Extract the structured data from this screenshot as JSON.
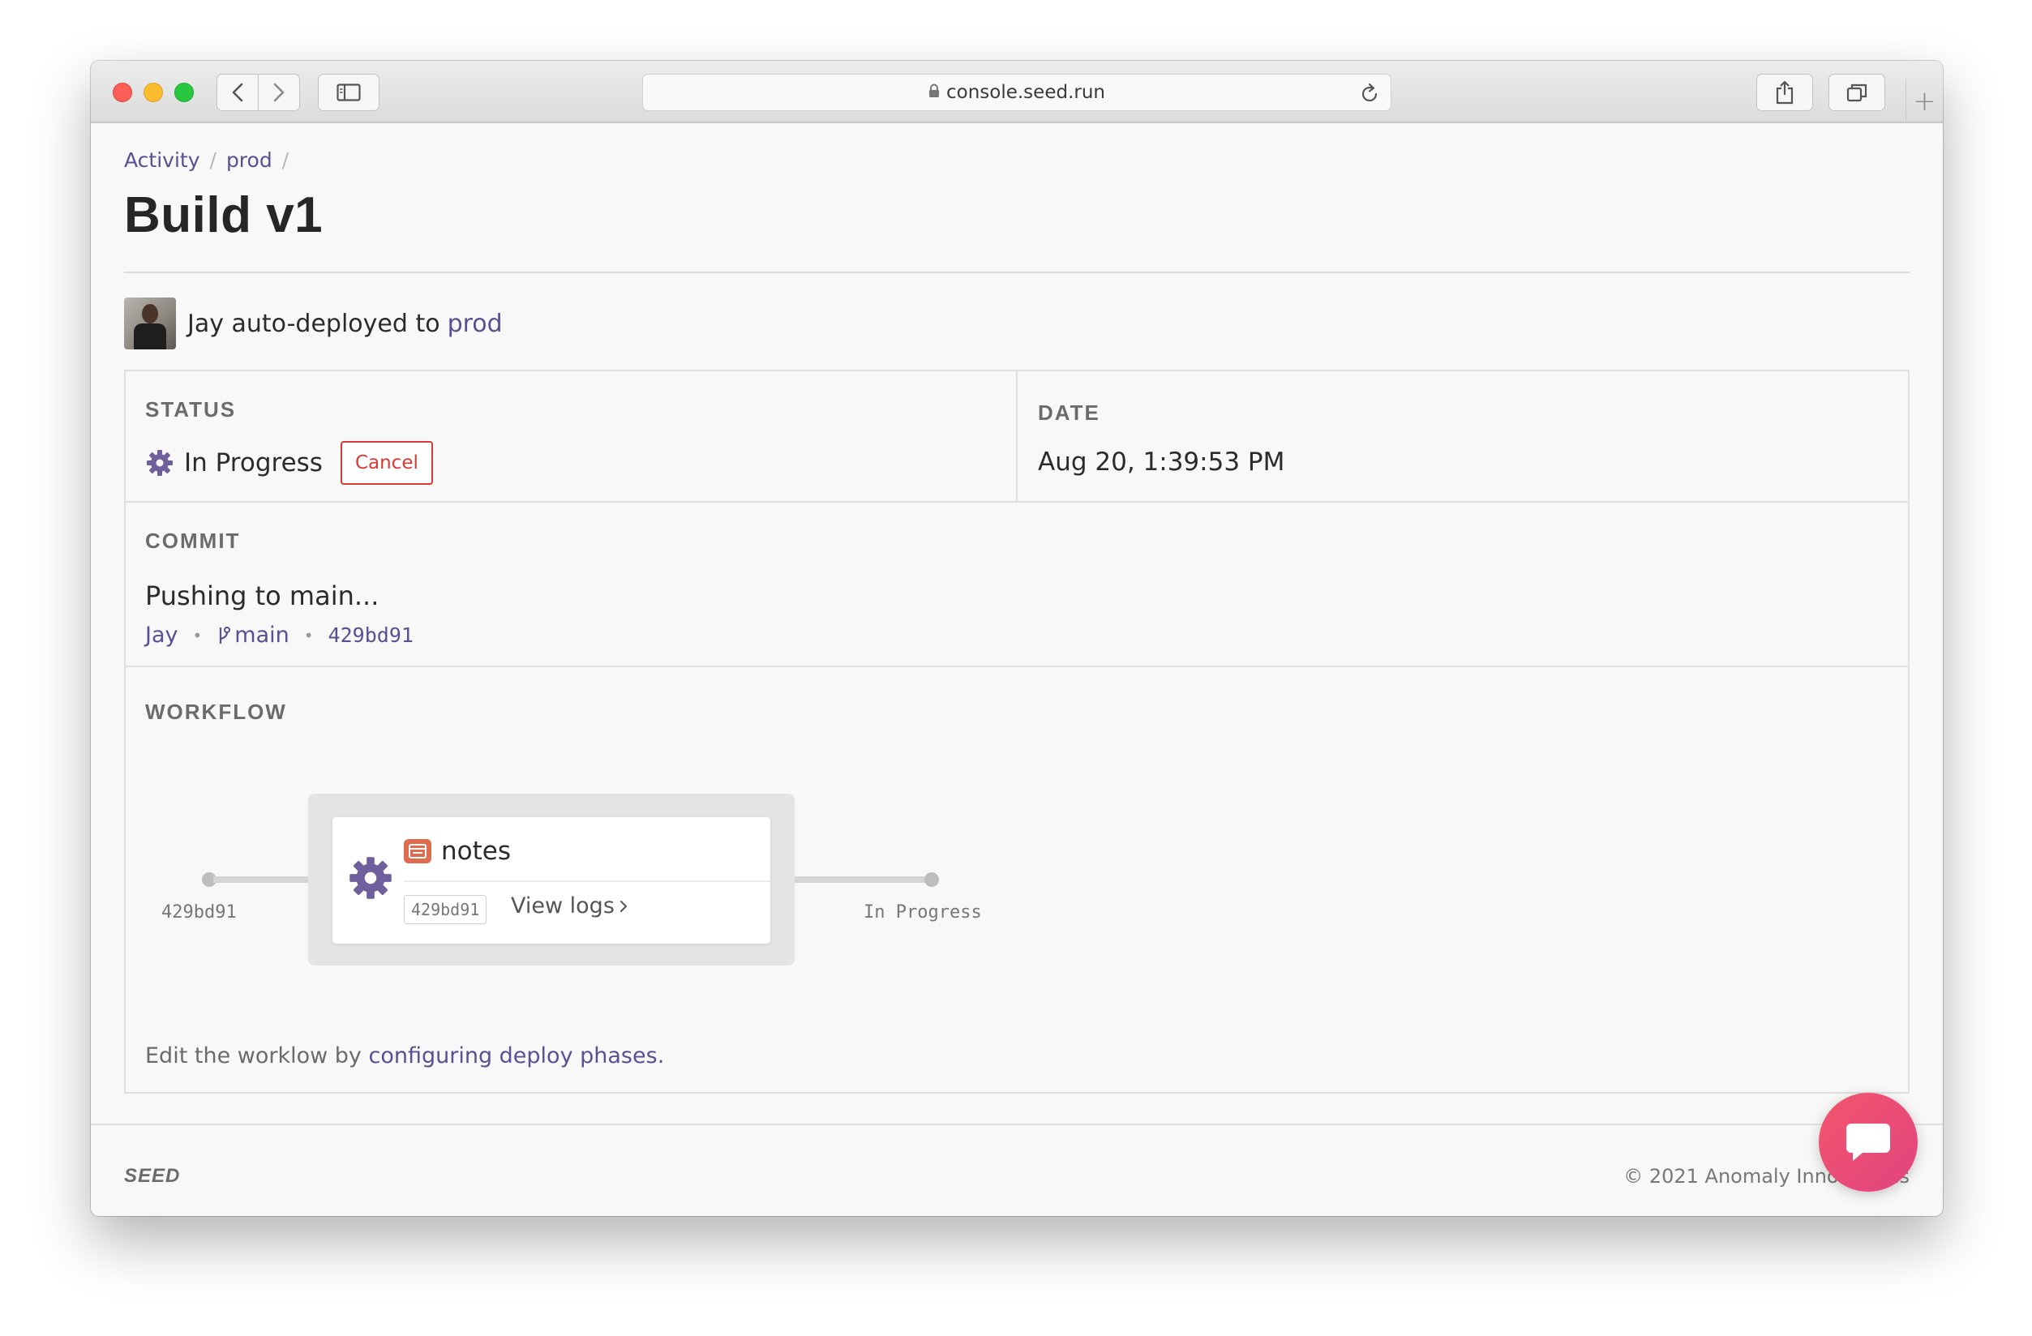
{
  "browser": {
    "url": "console.seed.run"
  },
  "breadcrumb": {
    "items": [
      "Activity",
      "prod"
    ],
    "separator": "/"
  },
  "page": {
    "title": "Build v1"
  },
  "deployer": {
    "text": "Jay auto-deployed to",
    "stage_link": "prod"
  },
  "status": {
    "label": "STATUS",
    "value": "In Progress",
    "cancel_label": "Cancel"
  },
  "date": {
    "label": "DATE",
    "value": "Aug 20, 1:39:53 PM"
  },
  "commit": {
    "label": "COMMIT",
    "message": "Pushing to main...",
    "author": "Jay",
    "branch": "main",
    "hash": "429bd91"
  },
  "workflow": {
    "label": "WORKFLOW",
    "start_label": "429bd91",
    "end_label": "In Progress",
    "service": {
      "name": "notes",
      "hash": "429bd91",
      "view_logs_label": "View logs"
    },
    "hint_prefix": "Edit the worklow by",
    "hint_link": "configuring deploy phases",
    "hint_suffix": "."
  },
  "footer": {
    "logo": "SEED",
    "copyright": "© 2021 Anomaly Innovations"
  },
  "colors": {
    "accent": "#5a4f92",
    "danger": "#d83a35",
    "gear": "#6f5f9d",
    "chat": "#f3566d"
  }
}
